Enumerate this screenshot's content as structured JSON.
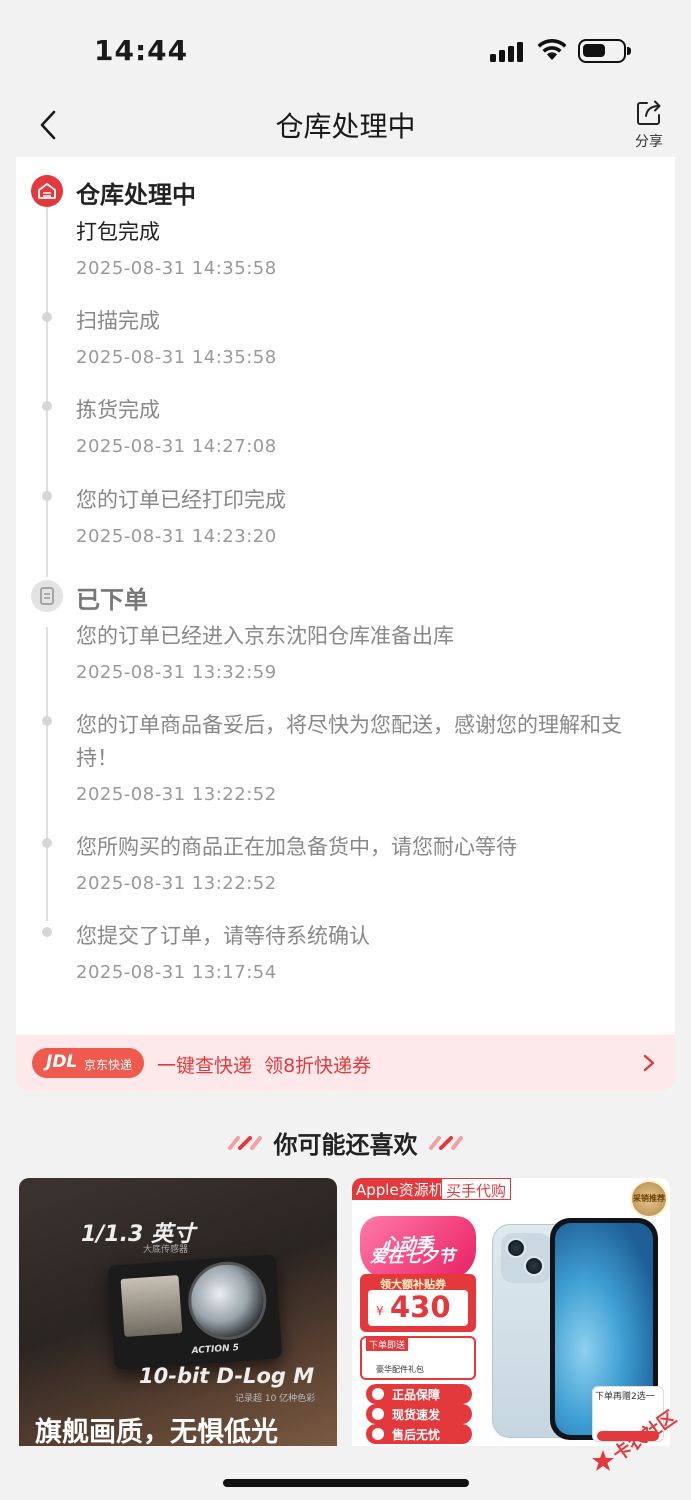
{
  "status_bar": {
    "time": "14:44"
  },
  "nav": {
    "title": "仓库处理中",
    "share_label": "分享"
  },
  "timeline": {
    "group1": {
      "heading": "仓库处理中",
      "events": [
        {
          "text": "打包完成",
          "time": "2025-08-31 14:35:58"
        },
        {
          "text": "扫描完成",
          "time": "2025-08-31 14:35:58"
        },
        {
          "text": "拣货完成",
          "time": "2025-08-31 14:27:08"
        },
        {
          "text": "您的订单已经打印完成",
          "time": "2025-08-31 14:23:20"
        }
      ]
    },
    "group2": {
      "heading": "已下单",
      "events": [
        {
          "text": "您的订单已经进入京东沈阳仓库准备出库",
          "time": "2025-08-31 13:32:59"
        },
        {
          "text": "您的订单商品备妥后，将尽快为您配送，感谢您的理解和支持！",
          "time": "2025-08-31 13:22:52"
        },
        {
          "text": "您所购买的商品正在加急备货中，请您耐心等待",
          "time": "2025-08-31 13:22:52"
        },
        {
          "text": "您提交了订单，请等待系统确认",
          "time": "2025-08-31 13:17:54"
        }
      ]
    }
  },
  "jdl_banner": {
    "logo_mark": "JDL",
    "logo_name": "京东快递",
    "text": "一键查快递  领8折快递券"
  },
  "recommend": {
    "title": "你可能还喜欢",
    "products": [
      {
        "size_text": "1/1.3 英寸",
        "size_sub": "大底传感器",
        "model_label": "ACTION 5",
        "dlog_text": "10-bit D-Log M",
        "dlog_sub": "记录超 10 亿种色彩",
        "slogan": "旗舰画质，无惧低光"
      },
      {
        "shop_tag": "Apple资源机",
        "tag2": "买手代购",
        "seal": "采销推荐",
        "promo_line1": "心动季",
        "promo_line2": "爱在七夕节",
        "coupon_title": "领大额补贴券",
        "currency": "¥",
        "coupon_amount": "430",
        "gift_title": "下单即送",
        "gift_sub": "豪华配件礼包",
        "pills": [
          "正品保障",
          "现货速发",
          "售后无忧"
        ],
        "mini_card_text": "下单再赠2选一"
      }
    ]
  },
  "watermark": {
    "text": "卡农社区"
  },
  "colors": {
    "accent": "#e4393c",
    "banner_bg": "#fde9e9",
    "page_bg": "#f2f2f2"
  }
}
